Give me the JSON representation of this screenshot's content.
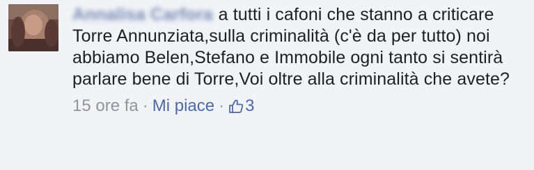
{
  "comment": {
    "author": "Annalisa Carfora",
    "text": "a tutti i cafoni che stanno a criticare Torre Annunziata,sulla criminalità (c'è da per tutto) noi abbiamo Belen,Stefano e Immobile ogni tanto si sentirà parlare bene di Torre,Voi oltre alla criminalità che avete?",
    "timestamp": "15 ore fa",
    "separator": "·",
    "like_label": "Mi piace",
    "like_count": "3",
    "like_icon": "thumbs-up-icon",
    "colors": {
      "background": "#f2f3f6",
      "text": "#1e1f22",
      "link": "#4e69a2",
      "meta": "#90949c"
    }
  }
}
